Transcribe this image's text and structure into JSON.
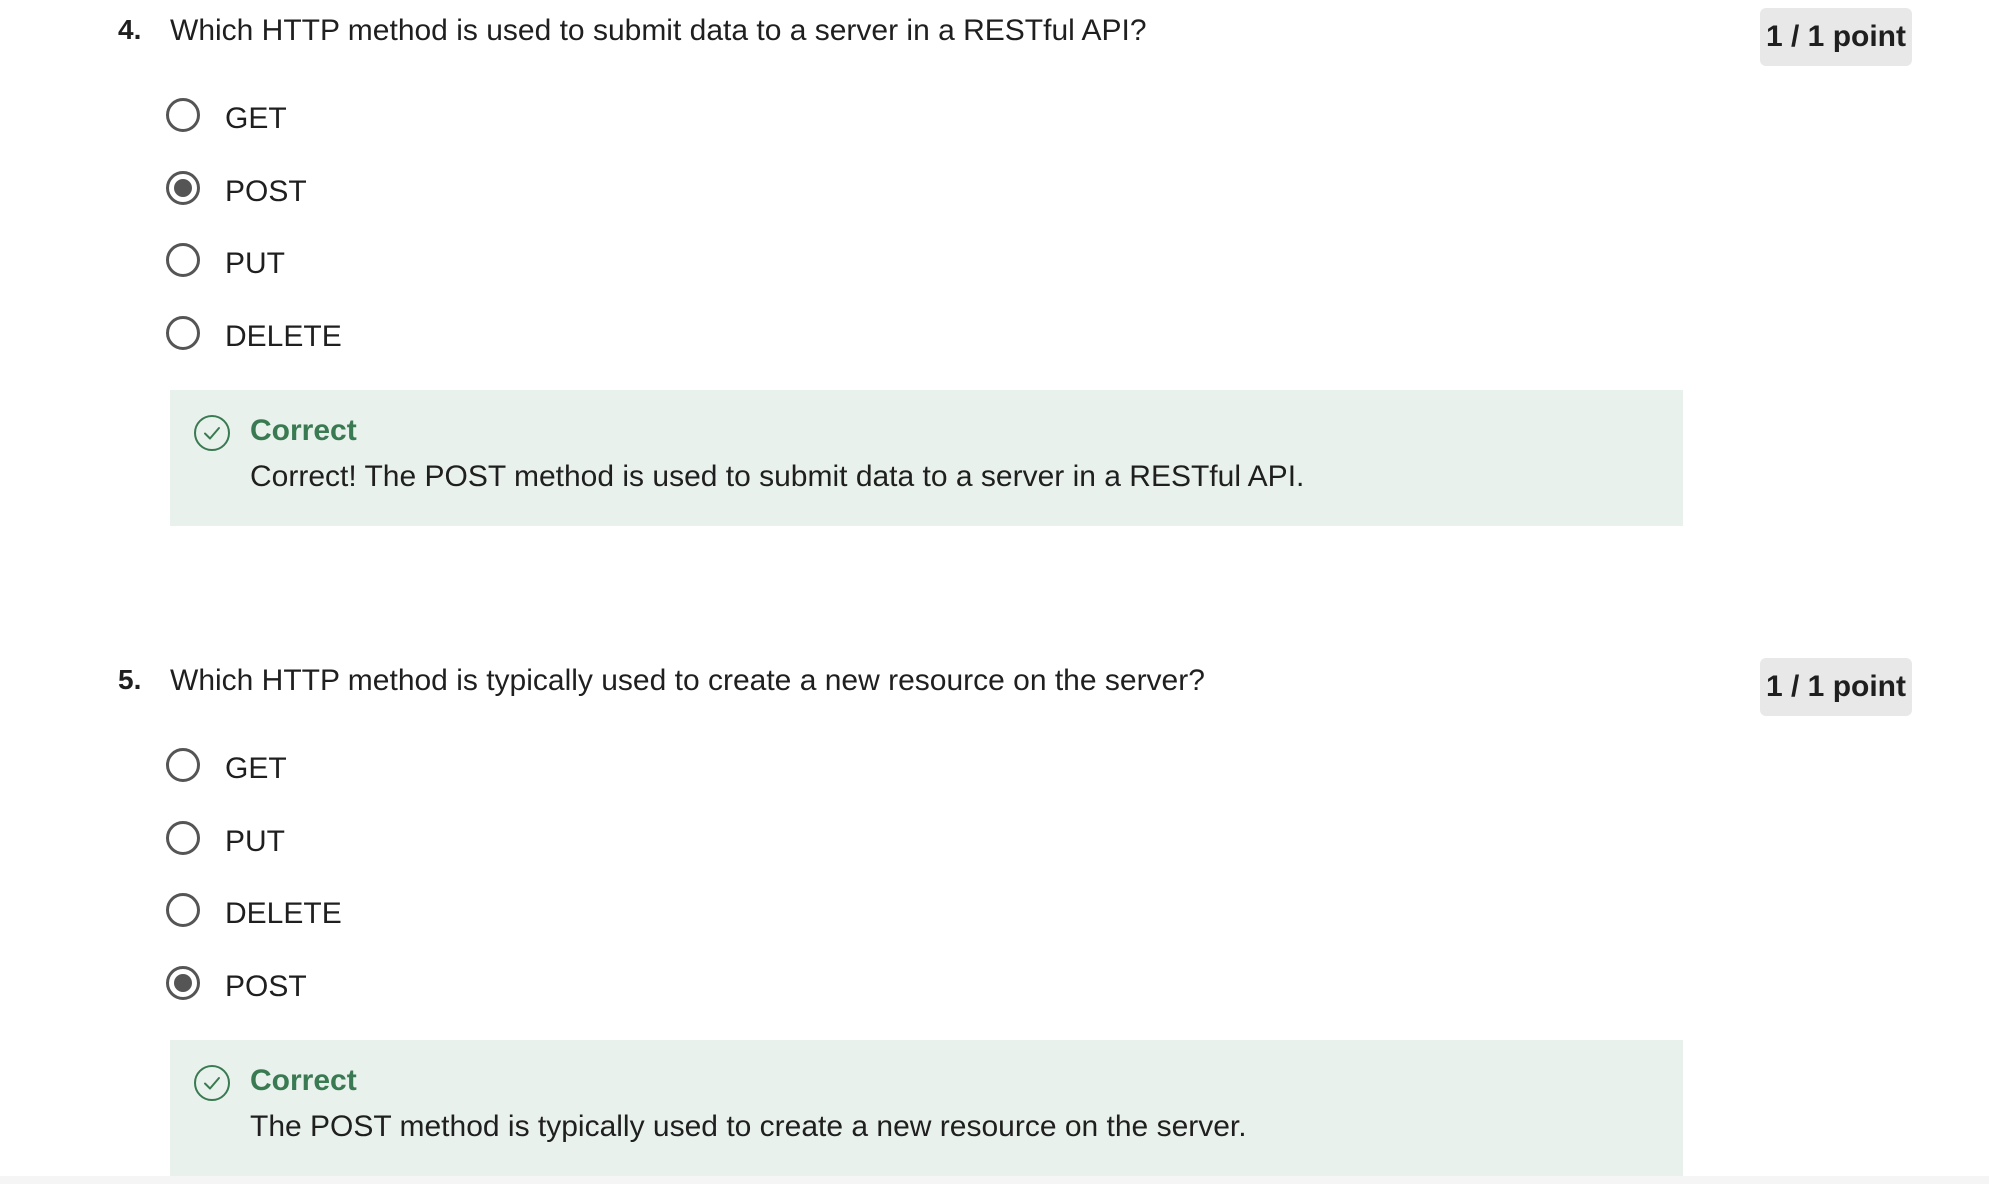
{
  "questions": [
    {
      "number": "4.",
      "text": "Which HTTP method is used to submit data to a server in a RESTful API?",
      "points": "1 / 1 point",
      "options": [
        {
          "label": "GET",
          "selected": false
        },
        {
          "label": "POST",
          "selected": true
        },
        {
          "label": "PUT",
          "selected": false
        },
        {
          "label": "DELETE",
          "selected": false
        }
      ],
      "feedback": {
        "title": "Correct",
        "text": "Correct! The POST method is used to submit data to a server in a RESTful API.",
        "icon": "check-circle-icon"
      }
    },
    {
      "number": "5.",
      "text": "Which HTTP method is typically used to create a new resource on the server?",
      "points": "1 / 1 point",
      "options": [
        {
          "label": "GET",
          "selected": false
        },
        {
          "label": "PUT",
          "selected": false
        },
        {
          "label": "DELETE",
          "selected": false
        },
        {
          "label": "POST",
          "selected": true
        }
      ],
      "feedback": {
        "title": "Correct",
        "text": "The POST method is typically used to create a new resource on the server.",
        "icon": "check-circle-icon"
      }
    }
  ],
  "colors": {
    "correct_accent": "#3a7a52",
    "feedback_bg": "#e9f1ec",
    "badge_bg": "#e8e8e8",
    "radio": "#555555"
  }
}
